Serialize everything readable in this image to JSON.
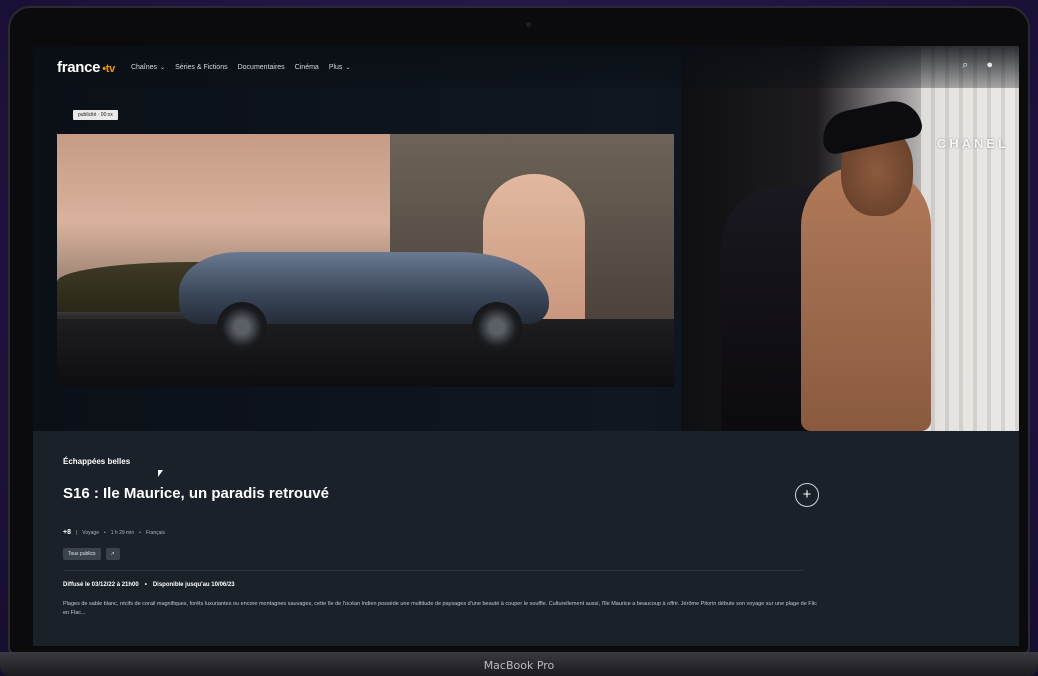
{
  "device": {
    "label": "MacBook Pro"
  },
  "nav": {
    "logo_text": "france",
    "logo_suffix": "•tv",
    "items": [
      {
        "label": "Chaînes",
        "dropdown": true
      },
      {
        "label": "Séries & Fictions",
        "dropdown": false
      },
      {
        "label": "Documentaires",
        "dropdown": false
      },
      {
        "label": "Cinéma",
        "dropdown": false
      },
      {
        "label": "Plus",
        "dropdown": true
      }
    ],
    "search_icon": "search-icon",
    "account_icon": "user-icon"
  },
  "hero": {
    "ad_tag": "publicité · 00:xx",
    "ad_brand": "CHANEL"
  },
  "program": {
    "show_name": "Échappées belles",
    "episode_title": "S16 : Ile Maurice, un paradis retrouvé",
    "age_rating": "+8",
    "meta": [
      "Voyage",
      "1 h 29 min",
      "Français"
    ],
    "badges": [
      "Tous publics",
      "↗"
    ],
    "broadcast": "Diffusé le 03/12/22 à 21h00",
    "availability": "Disponible jusqu'au 10/06/23",
    "description": "Plages de sable blanc, récifs de corail magnifiques, forêts luxuriantes ou encore montagnes sauvages, cette île de l'océan Indien possède une multitude de paysages d'une beauté à couper le souffle. Culturellement aussi, l'île Maurice a beaucoup à offrir. Jérôme Pitorin débute son voyage sur une plage de Flic en Flac..."
  },
  "colors": {
    "accent": "#f29400",
    "background": "#1a2129"
  }
}
